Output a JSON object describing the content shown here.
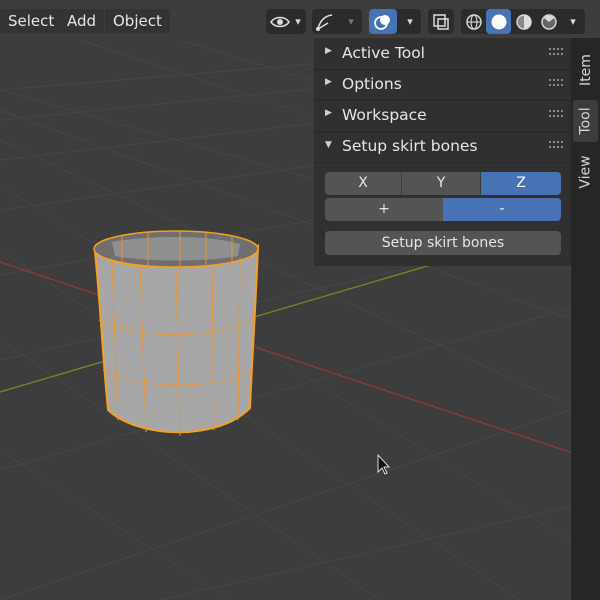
{
  "header": {
    "menus": [
      "Select",
      "Add",
      "Object"
    ],
    "icons": [
      "eye-visibility-icon",
      "chevron-down-icon",
      "gizmo-icon",
      "chevron-down-icon",
      "overlays-icon",
      "chevron-down-icon",
      "xray-icon",
      "wireframe-shading-icon",
      "solid-shading-icon",
      "material-preview-icon",
      "rendered-shading-icon",
      "chevron-down-icon"
    ]
  },
  "panel": {
    "sections": [
      {
        "label": "Active Tool",
        "expanded": false
      },
      {
        "label": "Options",
        "expanded": false
      },
      {
        "label": "Workspace",
        "expanded": false
      },
      {
        "label": "Setup skirt bones",
        "expanded": true
      }
    ],
    "axis_buttons": [
      {
        "label": "X",
        "active": false
      },
      {
        "label": "Y",
        "active": false
      },
      {
        "label": "Z",
        "active": true
      }
    ],
    "sign_buttons": [
      {
        "label": "+",
        "active": false
      },
      {
        "label": "-",
        "active": true
      }
    ],
    "action_button": "Setup skirt bones"
  },
  "tabs": [
    {
      "label": "Item",
      "active": false
    },
    {
      "label": "Tool",
      "active": true
    },
    {
      "label": "View",
      "active": false
    }
  ],
  "colors": {
    "background": "#3d3d3d",
    "panel": "#303030",
    "accent": "#4772b3",
    "selection_outline": "#f5a020",
    "x_axis": "#993a3a",
    "y_axis": "#6a8a2a"
  }
}
